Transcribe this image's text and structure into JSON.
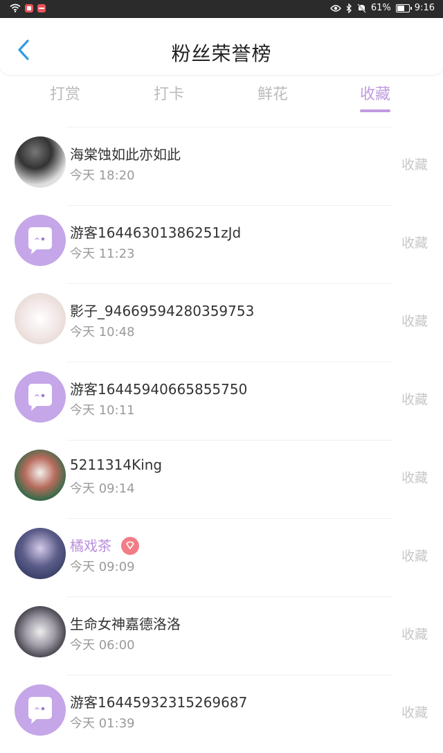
{
  "status_bar": {
    "battery": "61%",
    "time": "9:16"
  },
  "header": {
    "title": "粉丝荣誉榜"
  },
  "tabs": [
    {
      "label": "打赏",
      "active": false
    },
    {
      "label": "打卡",
      "active": false
    },
    {
      "label": "鲜花",
      "active": false
    },
    {
      "label": "收藏",
      "active": true
    }
  ],
  "accent_color": "#c09be0",
  "list": [
    {
      "name": "海棠蚀如此亦如此",
      "time": "今天 18:20",
      "action": "收藏",
      "avatar": "photo"
    },
    {
      "name": "游客16446301386251zJd",
      "time": "今天 11:23",
      "action": "收藏",
      "avatar": "guest-chat-icon"
    },
    {
      "name": "影子_94669594280359753",
      "time": "今天 10:48",
      "action": "收藏",
      "avatar": "photo"
    },
    {
      "name": "游客16445940665855750",
      "time": "今天 10:11",
      "action": "收藏",
      "avatar": "guest-chat-icon"
    },
    {
      "name": "5211314King",
      "time": "今天 09:14",
      "action": "收藏",
      "avatar": "photo"
    },
    {
      "name": "橘戏茶",
      "time": "今天 09:09",
      "action": "收藏",
      "avatar": "photo",
      "vip": true
    },
    {
      "name": "生命女神嘉德洛洛",
      "time": "今天 06:00",
      "action": "收藏",
      "avatar": "photo"
    },
    {
      "name": "游客16445932315269687",
      "time": "今天 01:39",
      "action": "收藏",
      "avatar": "guest-chat-icon"
    }
  ]
}
